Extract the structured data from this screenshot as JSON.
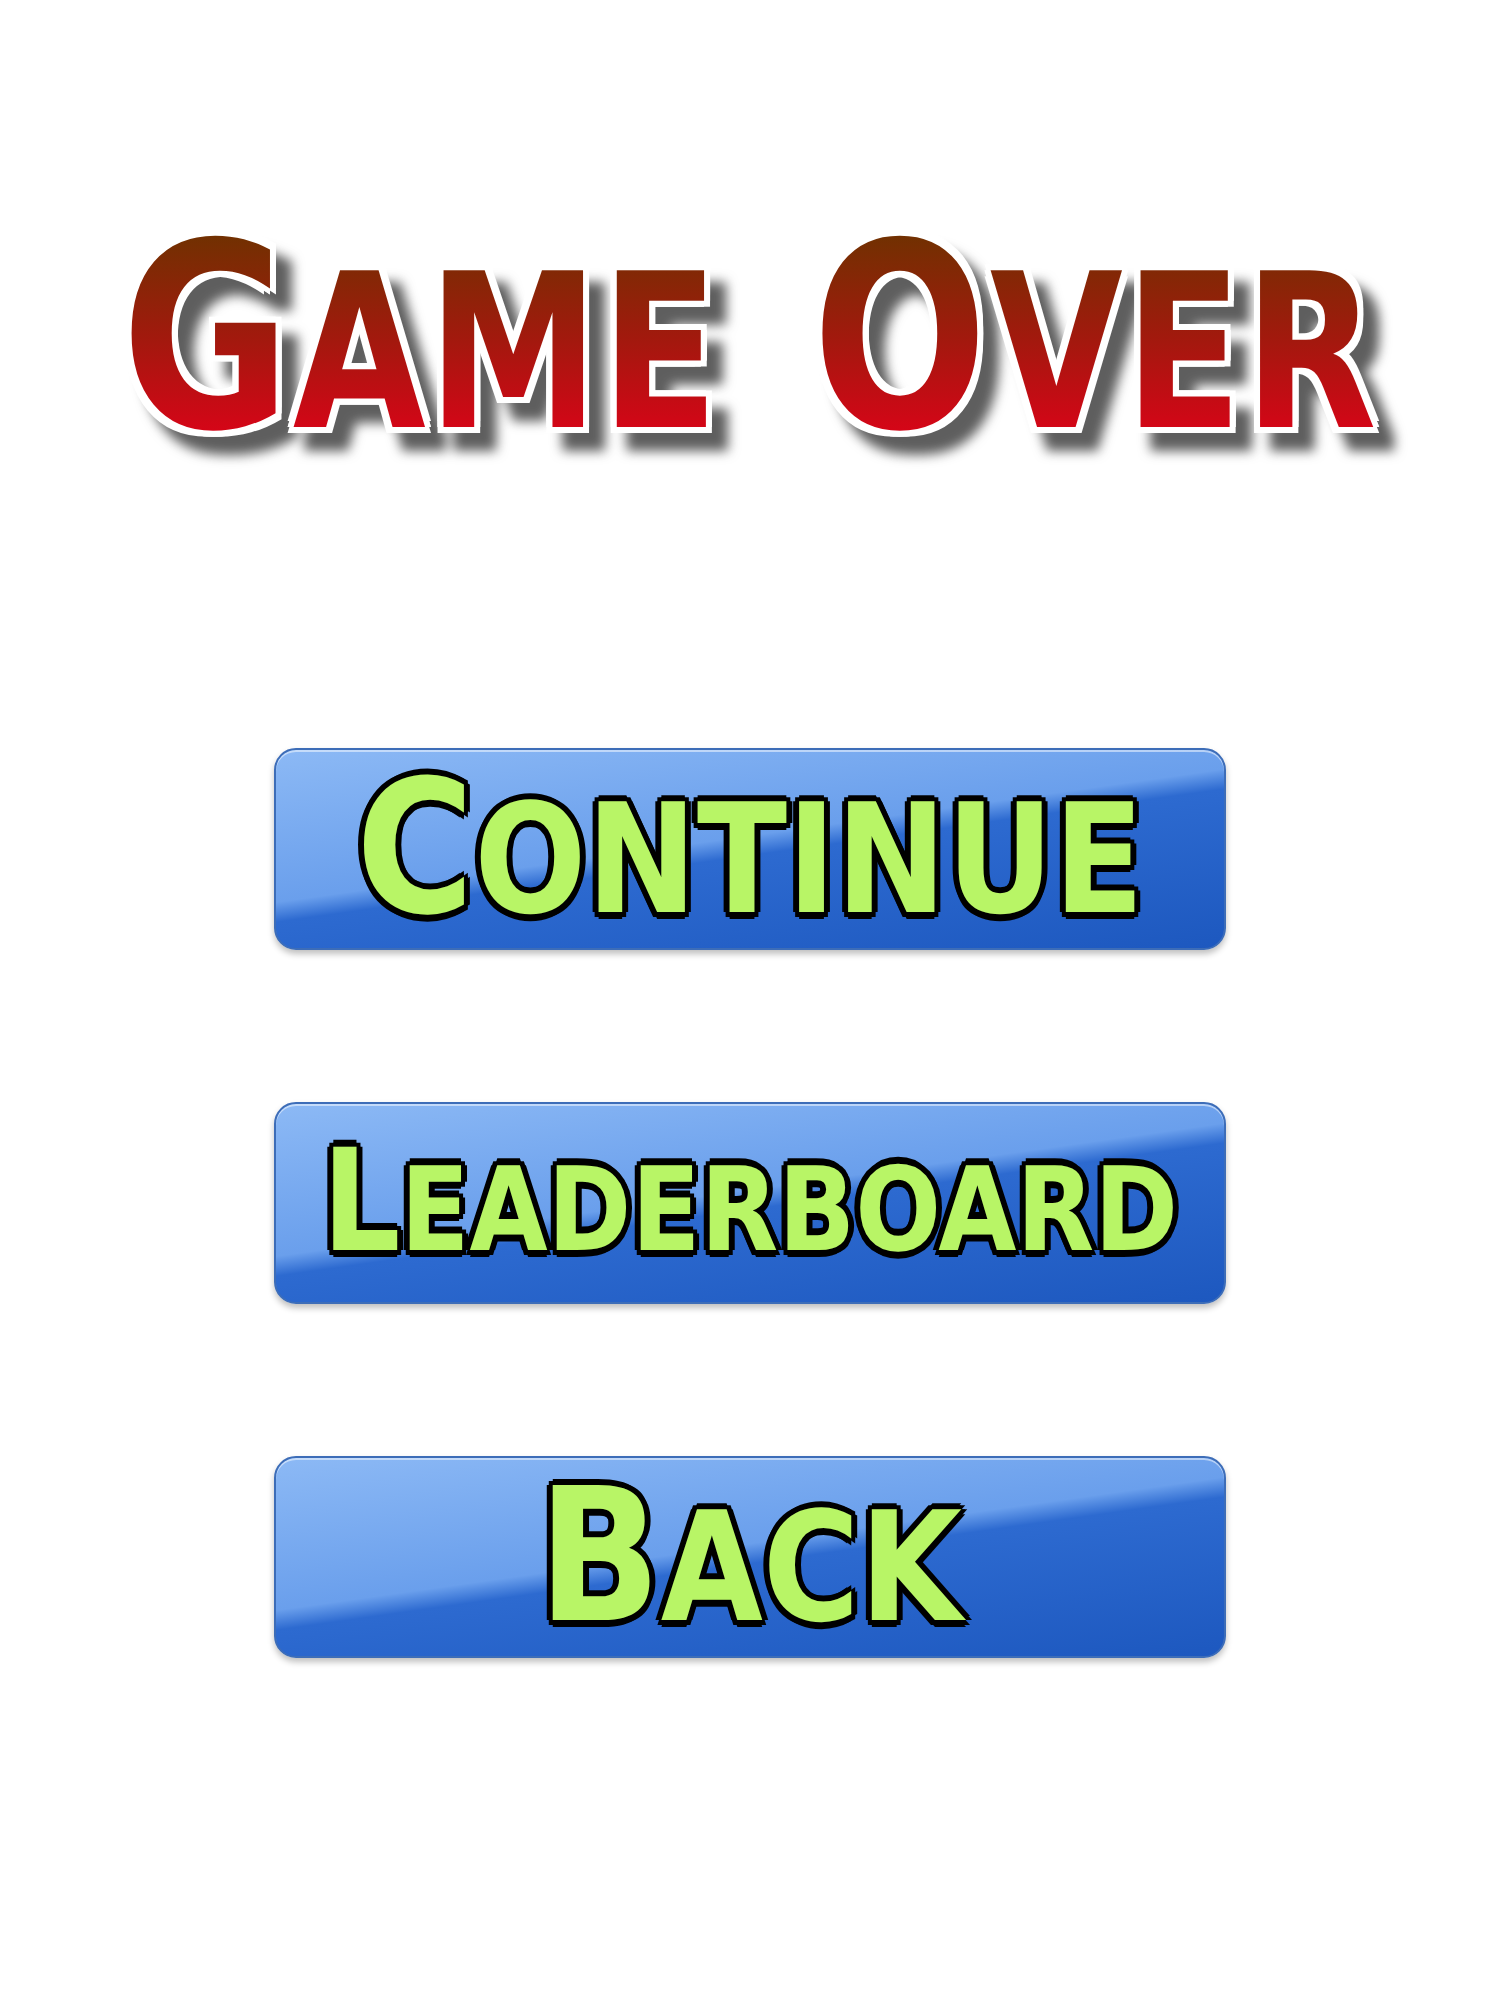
{
  "title": "GAME OVER",
  "buttons": [
    "CONTINUE",
    "LEADERBOARD",
    "BACK"
  ]
}
